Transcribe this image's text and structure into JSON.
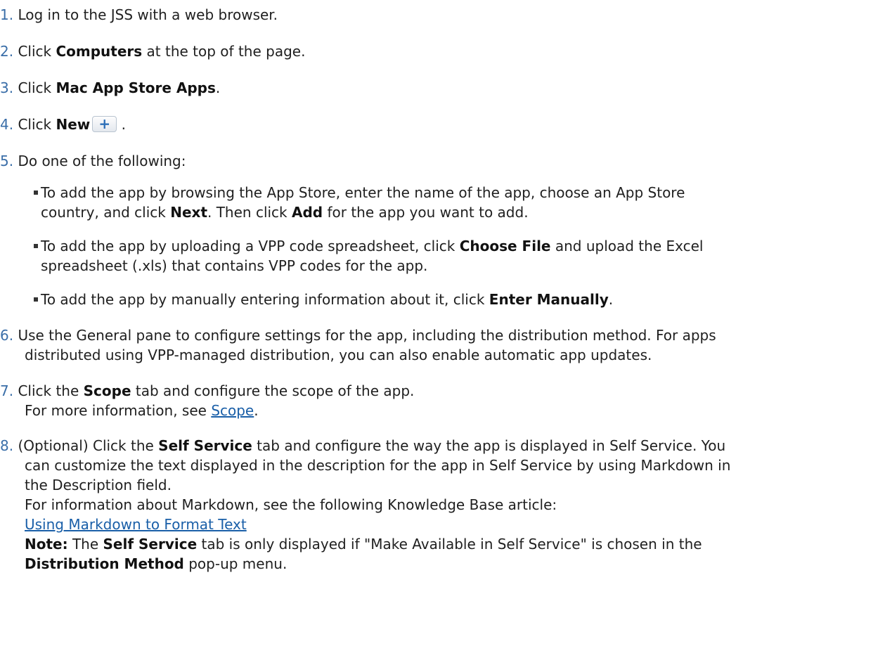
{
  "steps": [
    {
      "num": "1.",
      "text": "Log in to the JSS with a web browser."
    },
    {
      "num": "2.",
      "pre": "Click ",
      "bold": "Computers",
      "post": " at the top of the page."
    },
    {
      "num": "3.",
      "pre": "Click ",
      "bold": "Mac App Store Apps",
      "post": "."
    },
    {
      "num": "4.",
      "pre": "Click ",
      "bold": "New",
      "post": " .",
      "icon": "+"
    },
    {
      "num": "5.",
      "text": "Do one of the following:"
    },
    {
      "num": "6.",
      "line1": "Use the General pane to configure settings for the app, including the distribution method. For apps",
      "line2": "distributed using VPP-managed distribution, you can also enable automatic app updates."
    },
    {
      "num": "7.",
      "pre": "Click the ",
      "bold": "Scope",
      "post": " tab and configure the scope of the app.",
      "line2_pre": "For more information, see ",
      "link": "Scope",
      "line2_post": "."
    },
    {
      "num": "8.",
      "l1_pre": "(Optional) Click the ",
      "l1_bold": "Self Service",
      "l1_post": " tab and configure the way the app is displayed in Self Service. You",
      "l2": "can customize the text displayed in the description for the app in Self Service by using Markdown in",
      "l3": "the Description field.",
      "l4": "For information about Markdown, see the following Knowledge Base article:",
      "link": "Using Markdown to Format Text",
      "note_label": "Note:",
      "note_pre": " The ",
      "note_bold": "Self Service",
      "note_post": " tab is only displayed if \"Make Available in Self Service\" is chosen in the",
      "l7_bold": "Distribution Method",
      "l7_post": " pop-up menu."
    }
  ],
  "bullets": [
    {
      "l1_pre": "To add the app by browsing the App Store, enter the name of the app, choose an App Store",
      "l2_pre": "country, and click ",
      "b1": "Next",
      "l2_mid": ". Then click ",
      "b2": "Add",
      "l2_post": " for the app you want to add."
    },
    {
      "l1_pre": "To add the app by uploading a VPP code spreadsheet, click ",
      "b1": "Choose File",
      "l1_post": " and upload the Excel",
      "l2": "spreadsheet (.xls) that contains VPP codes for the app."
    },
    {
      "pre": "To add the app by manually entering information about it, click ",
      "b1": "Enter Manually",
      "post": "."
    }
  ]
}
